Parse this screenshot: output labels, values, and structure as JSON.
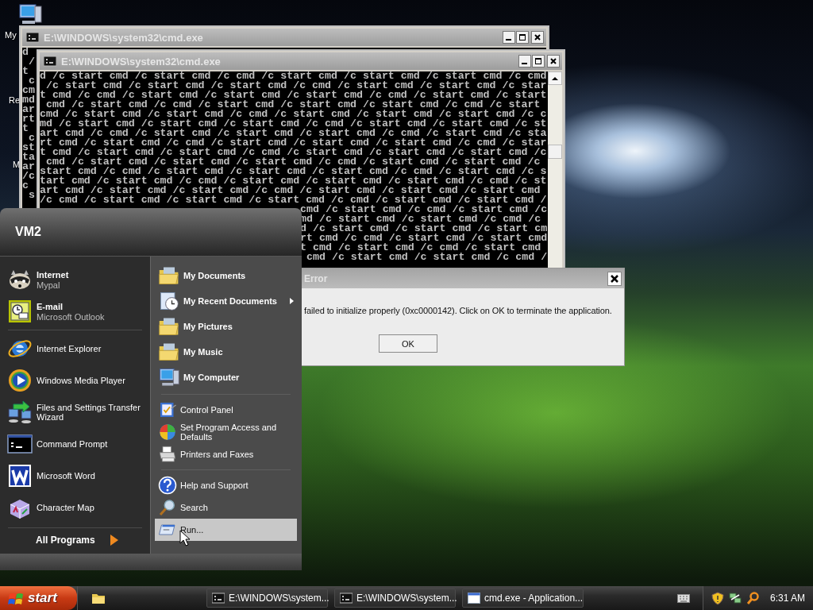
{
  "desktop_icons": [
    {
      "label": "My"
    },
    {
      "label": "Re"
    },
    {
      "label": "M"
    }
  ],
  "windows": [
    {
      "title": "E:\\WINDOWS\\system32\\cmd.exe",
      "console_lines": [
        "d",
        " /",
        "t",
        " c",
        "cm",
        "md",
        "ar",
        "rt",
        "t",
        " c",
        "st",
        "ta",
        "ar",
        "/c",
        "c",
        " s"
      ]
    },
    {
      "title": "E:\\WINDOWS\\system32\\cmd.exe",
      "console_lines": [
        "d /c start cmd /c start cmd /c cmd /c start cmd /c start cmd /c start cmd /c cmd",
        " /c start cmd /c start cmd /c start cmd /c cmd /c start cmd /c start cmd /c star",
        "t cmd /c cmd /c start cmd /c start cmd /c start cmd /c cmd /c start cmd /c start",
        " cmd /c start cmd /c cmd /c start cmd /c start cmd /c start cmd /c cmd /c start",
        "cmd /c start cmd /c start cmd /c cmd /c start cmd /c start cmd /c start cmd /c c",
        "md /c start cmd /c start cmd /c start cmd /c cmd /c start cmd /c start cmd /c st",
        "art cmd /c cmd /c start cmd /c start cmd /c start cmd /c cmd /c start cmd /c sta",
        "rt cmd /c start cmd /c cmd /c start cmd /c start cmd /c start cmd /c cmd /c star",
        "t cmd /c start cmd /c start cmd /c cmd /c start cmd /c start cmd /c start cmd /c",
        " cmd /c start cmd /c start cmd /c start cmd /c cmd /c start cmd /c start cmd /c ",
        "start cmd /c cmd /c start cmd /c start cmd /c start cmd /c cmd /c start cmd /c s",
        "tart cmd /c start cmd /c cmd /c start cmd /c start cmd /c start cmd /c cmd /c st",
        "art cmd /c start cmd /c start cmd /c cmd /c start cmd /c start cmd /c start cmd ",
        "/c cmd /c start cmd /c start cmd /c start cmd /c cmd /c start cmd /c start cmd /"
      ],
      "console_tail_lines": [
        "cmd /c start cmd /c cmd /c start cmd /c",
        "md /c start cmd /c start cmd /c cmd /c ",
        "d /c start cmd /c start cmd /c start cm",
        "rt cmd /c cmd /c start cmd /c start cmd",
        "t cmd /c start cmd /c cmd /c start cmd ",
        " cmd /c start cmd /c start cmd /c cmd /"
      ]
    }
  ],
  "error_dialog": {
    "title": "Error",
    "message": "failed to initialize properly (0xc0000142). Click on OK to terminate the application.",
    "button": "OK"
  },
  "start_menu": {
    "user": "VM2",
    "pinned": [
      {
        "title": "Internet",
        "subtitle": "Mypal"
      },
      {
        "title": "E-mail",
        "subtitle": "Microsoft Outlook"
      }
    ],
    "recent": [
      "Internet Explorer",
      "Windows Media Player",
      "Files and Settings Transfer Wizard",
      "Command Prompt",
      "Microsoft Word",
      "Character Map"
    ],
    "all_programs": "All Programs",
    "places_groups": [
      [
        {
          "label": "My Documents",
          "submenu": false,
          "selected": false
        },
        {
          "label": "My Recent Documents",
          "submenu": true,
          "selected": false
        },
        {
          "label": "My Pictures",
          "submenu": false,
          "selected": false
        },
        {
          "label": "My Music",
          "submenu": false,
          "selected": false
        },
        {
          "label": "My Computer",
          "submenu": false,
          "selected": false
        }
      ],
      [
        {
          "label": "Control Panel",
          "submenu": false,
          "selected": false
        },
        {
          "label": "Set Program Access and Defaults",
          "submenu": false,
          "selected": false
        },
        {
          "label": "Printers and Faxes",
          "submenu": false,
          "selected": false
        }
      ],
      [
        {
          "label": "Help and Support",
          "submenu": false,
          "selected": false
        },
        {
          "label": "Search",
          "submenu": false,
          "selected": false
        },
        {
          "label": "Run...",
          "submenu": false,
          "selected": true
        }
      ]
    ]
  },
  "taskbar": {
    "start": "start",
    "tasks": [
      {
        "label": "E:\\WINDOWS\\system...",
        "selected": false
      },
      {
        "label": "E:\\WINDOWS\\system...",
        "selected": false
      },
      {
        "label": "cmd.exe - Application...",
        "selected": false
      }
    ],
    "clock": "6:31 AM"
  }
}
